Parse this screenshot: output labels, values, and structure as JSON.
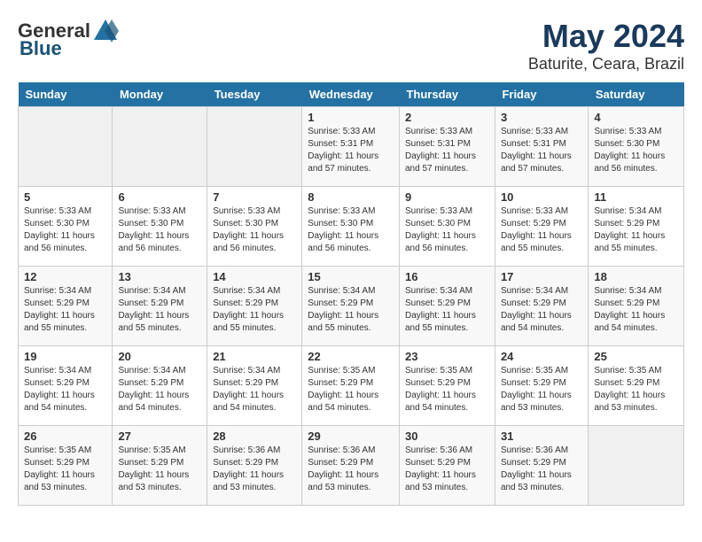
{
  "header": {
    "logo_general": "General",
    "logo_blue": "Blue",
    "title": "May 2024",
    "subtitle": "Baturite, Ceara, Brazil"
  },
  "calendar": {
    "days_of_week": [
      "Sunday",
      "Monday",
      "Tuesday",
      "Wednesday",
      "Thursday",
      "Friday",
      "Saturday"
    ],
    "weeks": [
      [
        {
          "day": "",
          "info": ""
        },
        {
          "day": "",
          "info": ""
        },
        {
          "day": "",
          "info": ""
        },
        {
          "day": "1",
          "info": "Sunrise: 5:33 AM\nSunset: 5:31 PM\nDaylight: 11 hours\nand 57 minutes."
        },
        {
          "day": "2",
          "info": "Sunrise: 5:33 AM\nSunset: 5:31 PM\nDaylight: 11 hours\nand 57 minutes."
        },
        {
          "day": "3",
          "info": "Sunrise: 5:33 AM\nSunset: 5:31 PM\nDaylight: 11 hours\nand 57 minutes."
        },
        {
          "day": "4",
          "info": "Sunrise: 5:33 AM\nSunset: 5:30 PM\nDaylight: 11 hours\nand 56 minutes."
        }
      ],
      [
        {
          "day": "5",
          "info": "Sunrise: 5:33 AM\nSunset: 5:30 PM\nDaylight: 11 hours\nand 56 minutes."
        },
        {
          "day": "6",
          "info": "Sunrise: 5:33 AM\nSunset: 5:30 PM\nDaylight: 11 hours\nand 56 minutes."
        },
        {
          "day": "7",
          "info": "Sunrise: 5:33 AM\nSunset: 5:30 PM\nDaylight: 11 hours\nand 56 minutes."
        },
        {
          "day": "8",
          "info": "Sunrise: 5:33 AM\nSunset: 5:30 PM\nDaylight: 11 hours\nand 56 minutes."
        },
        {
          "day": "9",
          "info": "Sunrise: 5:33 AM\nSunset: 5:30 PM\nDaylight: 11 hours\nand 56 minutes."
        },
        {
          "day": "10",
          "info": "Sunrise: 5:33 AM\nSunset: 5:29 PM\nDaylight: 11 hours\nand 55 minutes."
        },
        {
          "day": "11",
          "info": "Sunrise: 5:34 AM\nSunset: 5:29 PM\nDaylight: 11 hours\nand 55 minutes."
        }
      ],
      [
        {
          "day": "12",
          "info": "Sunrise: 5:34 AM\nSunset: 5:29 PM\nDaylight: 11 hours\nand 55 minutes."
        },
        {
          "day": "13",
          "info": "Sunrise: 5:34 AM\nSunset: 5:29 PM\nDaylight: 11 hours\nand 55 minutes."
        },
        {
          "day": "14",
          "info": "Sunrise: 5:34 AM\nSunset: 5:29 PM\nDaylight: 11 hours\nand 55 minutes."
        },
        {
          "day": "15",
          "info": "Sunrise: 5:34 AM\nSunset: 5:29 PM\nDaylight: 11 hours\nand 55 minutes."
        },
        {
          "day": "16",
          "info": "Sunrise: 5:34 AM\nSunset: 5:29 PM\nDaylight: 11 hours\nand 55 minutes."
        },
        {
          "day": "17",
          "info": "Sunrise: 5:34 AM\nSunset: 5:29 PM\nDaylight: 11 hours\nand 54 minutes."
        },
        {
          "day": "18",
          "info": "Sunrise: 5:34 AM\nSunset: 5:29 PM\nDaylight: 11 hours\nand 54 minutes."
        }
      ],
      [
        {
          "day": "19",
          "info": "Sunrise: 5:34 AM\nSunset: 5:29 PM\nDaylight: 11 hours\nand 54 minutes."
        },
        {
          "day": "20",
          "info": "Sunrise: 5:34 AM\nSunset: 5:29 PM\nDaylight: 11 hours\nand 54 minutes."
        },
        {
          "day": "21",
          "info": "Sunrise: 5:34 AM\nSunset: 5:29 PM\nDaylight: 11 hours\nand 54 minutes."
        },
        {
          "day": "22",
          "info": "Sunrise: 5:35 AM\nSunset: 5:29 PM\nDaylight: 11 hours\nand 54 minutes."
        },
        {
          "day": "23",
          "info": "Sunrise: 5:35 AM\nSunset: 5:29 PM\nDaylight: 11 hours\nand 54 minutes."
        },
        {
          "day": "24",
          "info": "Sunrise: 5:35 AM\nSunset: 5:29 PM\nDaylight: 11 hours\nand 53 minutes."
        },
        {
          "day": "25",
          "info": "Sunrise: 5:35 AM\nSunset: 5:29 PM\nDaylight: 11 hours\nand 53 minutes."
        }
      ],
      [
        {
          "day": "26",
          "info": "Sunrise: 5:35 AM\nSunset: 5:29 PM\nDaylight: 11 hours\nand 53 minutes."
        },
        {
          "day": "27",
          "info": "Sunrise: 5:35 AM\nSunset: 5:29 PM\nDaylight: 11 hours\nand 53 minutes."
        },
        {
          "day": "28",
          "info": "Sunrise: 5:36 AM\nSunset: 5:29 PM\nDaylight: 11 hours\nand 53 minutes."
        },
        {
          "day": "29",
          "info": "Sunrise: 5:36 AM\nSunset: 5:29 PM\nDaylight: 11 hours\nand 53 minutes."
        },
        {
          "day": "30",
          "info": "Sunrise: 5:36 AM\nSunset: 5:29 PM\nDaylight: 11 hours\nand 53 minutes."
        },
        {
          "day": "31",
          "info": "Sunrise: 5:36 AM\nSunset: 5:29 PM\nDaylight: 11 hours\nand 53 minutes."
        },
        {
          "day": "",
          "info": ""
        }
      ]
    ]
  }
}
